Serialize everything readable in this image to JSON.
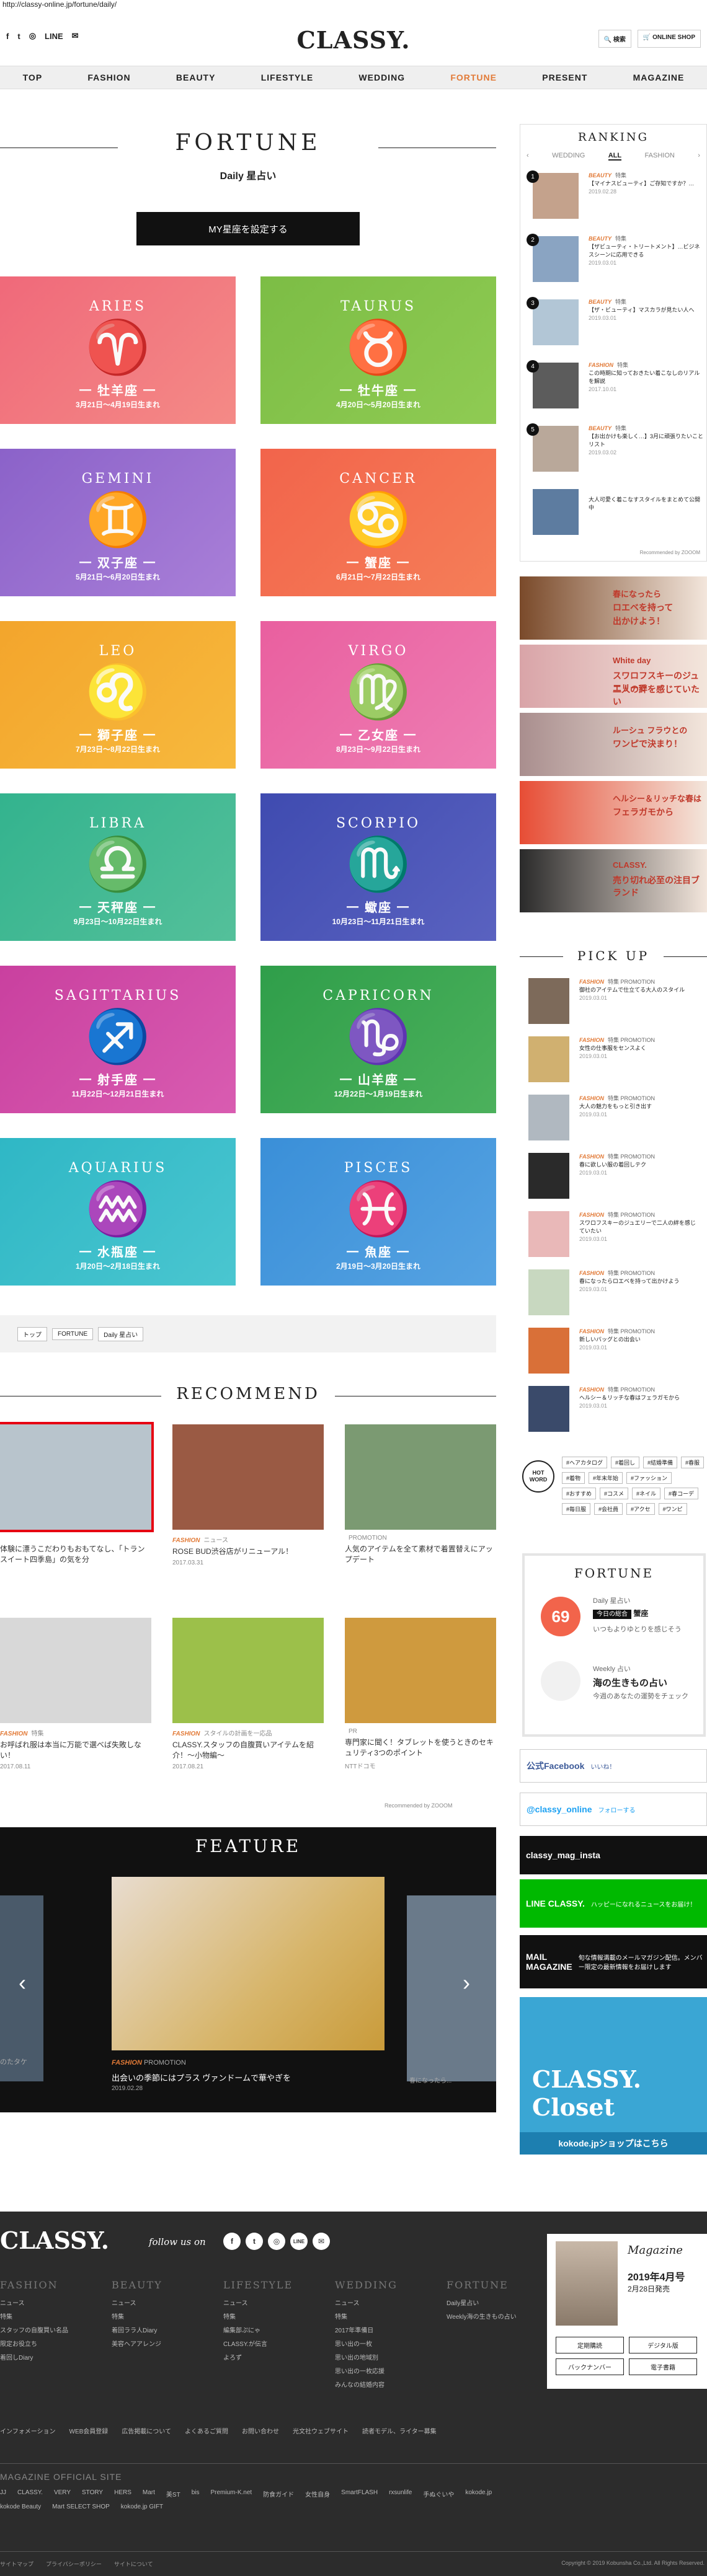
{
  "url": "http://classy-online.jp/fortune/daily/",
  "social": [
    "f",
    "t",
    "◎",
    "LINE",
    "✉"
  ],
  "logo": "CLASSY.",
  "top_buttons": {
    "search": "検索",
    "shop": "ONLINE SHOP"
  },
  "nav": [
    "TOP",
    "FASHION",
    "BEAUTY",
    "LIFESTYLE",
    "WEDDING",
    "FORTUNE",
    "PRESENT",
    "MAGAZINE"
  ],
  "header": {
    "title": "FORTUNE",
    "subtitle": "Daily 星占い",
    "set_button": "MY星座を設定する"
  },
  "zodiac": [
    {
      "en": "ARIES",
      "sym": "♈",
      "jp": "一 牡羊座 一",
      "date": "3月21日〜4月19日生まれ",
      "c1": "#f0697a",
      "c2": "#f48a86"
    },
    {
      "en": "TAURUS",
      "sym": "♉",
      "jp": "一 牡牛座 一",
      "date": "4月20日〜5月20日生まれ",
      "c1": "#7cbd45",
      "c2": "#8fcb53"
    },
    {
      "en": "GEMINI",
      "sym": "♊",
      "jp": "一 双子座 一",
      "date": "5月21日〜6月20日生まれ",
      "c1": "#8b62c9",
      "c2": "#a97fd8"
    },
    {
      "en": "CANCER",
      "sym": "♋",
      "jp": "一 蟹座 一",
      "date": "6月21日〜7月22日生まれ",
      "c1": "#f2644b",
      "c2": "#f57e58"
    },
    {
      "en": "LEO",
      "sym": "♌",
      "jp": "一 獅子座 一",
      "date": "7月23日〜8月22日生まれ",
      "c1": "#f3a52c",
      "c2": "#f7b93d"
    },
    {
      "en": "VIRGO",
      "sym": "♍",
      "jp": "一 乙女座 一",
      "date": "8月23日〜9月22日生まれ",
      "c1": "#e95f9f",
      "c2": "#ee7db3"
    },
    {
      "en": "LIBRA",
      "sym": "♎",
      "jp": "一 天秤座 一",
      "date": "9月23日〜10月22日生まれ",
      "c1": "#33b38e",
      "c2": "#54c09a"
    },
    {
      "en": "SCORPIO",
      "sym": "♏",
      "jp": "一 蠍座 一",
      "date": "10月23日〜11月21日生まれ",
      "c1": "#3f4bb0",
      "c2": "#5a62c0"
    },
    {
      "en": "SAGITTARIUS",
      "sym": "♐",
      "jp": "一 射手座 一",
      "date": "11月22日〜12月21日生まれ",
      "c1": "#c9409f",
      "c2": "#d95cb1"
    },
    {
      "en": "CAPRICORN",
      "sym": "♑",
      "jp": "一 山羊座 一",
      "date": "12月22日〜1月19日生まれ",
      "c1": "#2f9e4a",
      "c2": "#4cb15c"
    },
    {
      "en": "AQUARIUS",
      "sym": "♒",
      "jp": "一 水瓶座 一",
      "date": "1月20日〜2月18日生まれ",
      "c1": "#2fb7c5",
      "c2": "#4ac6d0"
    },
    {
      "en": "PISCES",
      "sym": "♓",
      "jp": "一 魚座 一",
      "date": "2月19日〜3月20日生まれ",
      "c1": "#3a8fd8",
      "c2": "#56a3e2"
    }
  ],
  "breadcrumb": [
    "トップ",
    "FORTUNE",
    "Daily 星占い"
  ],
  "recommend": {
    "title": "RECOMMEND",
    "items": [
      {
        "cat": "",
        "sub": "",
        "text": "体験に漂うこだわりもおもてなし、「トランスイート四季島」の気を分",
        "date": "",
        "bg": "#b8c4cc"
      },
      {
        "cat": "FASHION",
        "sub": "ニュース",
        "text": "ROSE BUD渋谷店がリニューアル！",
        "date": "2017.03.31",
        "bg": "#9a5a44"
      },
      {
        "cat": "",
        "sub": "PROMOTION",
        "text": "人気のアイテムを全て素材で着置替えにアップデート",
        "date": "",
        "bg": "#7b9a72"
      },
      {
        "cat": "FASHION",
        "sub": "特集",
        "text": "お呼ばれ服は本当に万能で選べば失敗しない！",
        "date": "2017.08.11",
        "bg": "#d8d8d8"
      },
      {
        "cat": "FASHION",
        "sub": "スタイルの計画を一応品",
        "text": "CLASSY.スタッフの自腹買いアイテムを紹介！〜小物編〜",
        "date": "2017.08.21",
        "bg": "#9cc04a"
      },
      {
        "cat": "",
        "sub": "PR",
        "text": "専門家に聞く！タブレットを使うときのセキュリティ3つのポイント",
        "date": "NTTドコモ",
        "bg": "#cf9a3e"
      }
    ],
    "powered": "Recommended by ZOOOM"
  },
  "feature": {
    "title": "FEATURE",
    "left_caption": "のたタケ",
    "cat": "FASHION",
    "sub": "PROMOTION",
    "text": "出会いの季節にはプラス ヴァンドームで華やぎを",
    "date": "2019.02.28",
    "right_text": "春になったら..."
  },
  "ranking": {
    "title": "RANKING",
    "tabs": [
      "WEDDING",
      "ALL",
      "FASHION"
    ],
    "items": [
      {
        "cat": "BEAUTY",
        "sub": "特集",
        "text": "【マイナスビューティ】ご存知ですか？…",
        "date": "2019.02.28",
        "bg": "#c4a28c"
      },
      {
        "cat": "BEAUTY",
        "sub": "特集",
        "text": "【ザビューティ・トリートメント】…ビジネスシーンに応用できる",
        "date": "2019.03.01",
        "bg": "#8aa4c2"
      },
      {
        "cat": "BEAUTY",
        "sub": "特集",
        "text": "【ザ・ビューティ】マスカラが見たい人へ",
        "date": "2019.03.01",
        "bg": "#b2c6d6"
      },
      {
        "cat": "FASHION",
        "sub": "特集",
        "text": "この時期に知っておきたい着こなしのリアルを解説",
        "date": "2017.10.01",
        "bg": "#5c5c5c"
      },
      {
        "cat": "BEAUTY",
        "sub": "特集",
        "text": "【お出かけも楽しく…】3月に頑張りたいことリスト",
        "date": "2019.03.02",
        "bg": "#b9a89a"
      },
      {
        "cat": "",
        "sub": "",
        "text": "大人可愛く着こなすスタイルをまとめて公開中",
        "date": "",
        "bg": "#5d7ca0"
      }
    ],
    "powered": "Recommended by ZOOOM"
  },
  "banners": [
    {
      "t1": "春になったら",
      "t2": "ロエベを持って",
      "t3": "出かけよう！",
      "bg": "#7a4a2a"
    },
    {
      "t1": "White day",
      "t2": "スワロフスキーのジュエリーで",
      "t3": "二人の絆を感じていたい",
      "bg": "#d9a4a8"
    },
    {
      "t1": "ルーシュ フラウとの",
      "t2": "ワンピで決まり！",
      "t3": "",
      "bg": "#a98e8e"
    },
    {
      "t1": "ヘルシー＆リッチな春は",
      "t2": "フェラガモから",
      "t3": "",
      "bg": "#e74d35"
    },
    {
      "t1": "CLASSY.",
      "t2": "売り切れ必至の注目ブランド",
      "t3": "",
      "bg": "#2a2a2a"
    }
  ],
  "pickup": {
    "title": "PICK UP",
    "items": [
      {
        "cat": "FASHION",
        "sub": "特集 PROMOTION",
        "text": "御社のアイテムで仕立てる大人のスタイル",
        "date": "2019.03.01",
        "bg": "#7d6a5a"
      },
      {
        "cat": "FASHION",
        "sub": "特集 PROMOTION",
        "text": "女性の仕事服をセンスよく",
        "date": "2019.03.01",
        "bg": "#d0b070"
      },
      {
        "cat": "FASHION",
        "sub": "特集 PROMOTION",
        "text": "大人の魅力をもっと引き出す",
        "date": "2019.03.01",
        "bg": "#b0b8c0"
      },
      {
        "cat": "FASHION",
        "sub": "特集 PROMOTION",
        "text": "春に欲しい服の着回しテク",
        "date": "2019.03.01",
        "bg": "#2a2a2a"
      },
      {
        "cat": "FASHION",
        "sub": "特集 PROMOTION",
        "text": "スワロフスキーのジュエリーで二人の絆を感じていたい",
        "date": "2019.03.01",
        "bg": "#e9b8b8"
      },
      {
        "cat": "FASHION",
        "sub": "特集 PROMOTION",
        "text": "春になったらロエベを持って出かけよう",
        "date": "2019.03.01",
        "bg": "#c8d8c0"
      },
      {
        "cat": "FASHION",
        "sub": "特集 PROMOTION",
        "text": "新しいバッグとの出会い",
        "date": "2019.03.01",
        "bg": "#d97038"
      },
      {
        "cat": "FASHION",
        "sub": "特集 PROMOTION",
        "text": "ヘルシー＆リッチな春はフェラガモから",
        "date": "2019.03.01",
        "bg": "#3a4a6a"
      }
    ]
  },
  "hot_word": {
    "label": "HOT WORD",
    "tags": [
      "#ヘアカタログ",
      "#着回し",
      "#結婚準備",
      "#春服",
      "#着物",
      "#年末年始",
      "#ファッション",
      "#おすすめ",
      "#コスメ",
      "#ネイル",
      "#春コーデ",
      "#毎日服",
      "#会社員",
      "#アクセ",
      "#ワンピ"
    ]
  },
  "fortune_box": {
    "title": "FORTUNE",
    "daily_label": "Daily 星占い",
    "daily_rank": "今日の総合",
    "daily_sign": "蟹座",
    "daily_text": "いつもよりゆとりを感じそう",
    "daily_num": "69",
    "weekly_label": "Weekly 占い",
    "weekly_title": "海の生きもの占い",
    "weekly_text": "今週のあなたの運勢をチェック"
  },
  "social_buttons": [
    {
      "label": "公式Facebook",
      "extra": "いいね！",
      "bg": "#fff",
      "fg": "#3b5998"
    },
    {
      "label": "@classy_online",
      "extra": "フォローする",
      "bg": "#fff",
      "fg": "#1da1f2"
    },
    {
      "label": "classy_mag_insta",
      "extra": "",
      "bg": "#111",
      "fg": "#fff"
    },
    {
      "label": "LINE CLASSY.",
      "extra": "ハッピーになれるニュースをお届け！",
      "bg": "#00b900",
      "fg": "#fff"
    },
    {
      "label": "MAIL MAGAZINE",
      "extra": "旬な情報満載のメールマガジン配信。メンバー限定の最新情報をお届けします",
      "bg": "#111",
      "fg": "#fff"
    }
  ],
  "kokode": {
    "title": "CLASSY. Closet",
    "text": "kokode.jpショップはこちら"
  },
  "footer": {
    "logo": "CLASSY.",
    "follow": "follow us on",
    "cols": [
      {
        "h": "FASHION",
        "items": [
          "ニュース",
          "特集",
          "スタッフの自腹買い名品",
          "限定お役立ち",
          "着回しDiary"
        ]
      },
      {
        "h": "BEAUTY",
        "items": [
          "ニュース",
          "特集",
          "着回ララ人Diary",
          "美容ヘアアレンジ"
        ]
      },
      {
        "h": "LIFESTYLE",
        "items": [
          "ニュース",
          "特集",
          "編集部ぷにゃ",
          "CLASSY.が伝言",
          "よろず"
        ]
      },
      {
        "h": "WEDDING",
        "items": [
          "ニュース",
          "特集",
          "2017年準備日",
          "思い出の一枚",
          "思い出の地域別",
          "思い出の一枚応援",
          "みんなの結婚内容"
        ]
      },
      {
        "h": "FORTUNE",
        "items": [
          "Daily星占い",
          "Weekly海の生きもの占い"
        ]
      }
    ],
    "magazine": {
      "t": "Magazine",
      "date": "2019年4月号",
      "sub": "2月28日発売",
      "btns": [
        "定期購読",
        "デジタル版",
        "バックナンバー",
        "電子書籍"
      ]
    },
    "links": [
      "インフォメーション",
      "WEB会員登録",
      "広告掲載について",
      "よくあるご質問",
      "お問い合わせ",
      "光文社ウェブサイト",
      "読者モデル、ライター募集"
    ],
    "official": "MAGAZINE OFFICIAL SITE",
    "mags": [
      "JJ",
      "CLASSY.",
      "VERY",
      "STORY",
      "HERS",
      "Mart",
      "美ST",
      "bis",
      "Premium-K.net",
      "防食ガイド",
      "女性自身",
      "SmartFLASH",
      "rxsunlife",
      "手ぬぐいや",
      "kokode.jp",
      "kokode Beauty",
      "Mart SELECT SHOP",
      "kokode.jp GIFT"
    ],
    "bottom": [
      "サイトマップ",
      "プライバシーポリシー",
      "サイトについて"
    ],
    "copyright": "Copyright © 2019 Kobunsha Co.,Ltd. All Rights Reserved."
  }
}
